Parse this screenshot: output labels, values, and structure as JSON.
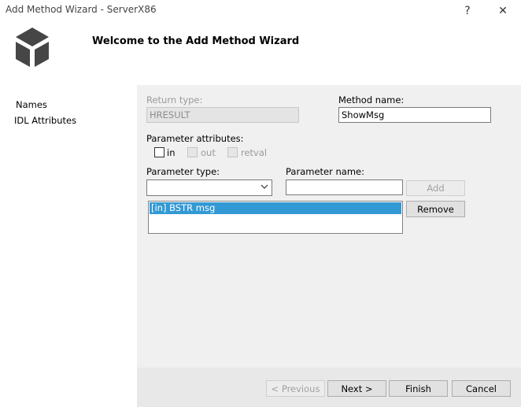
{
  "window": {
    "title": "Add Method Wizard - ServerX86",
    "help_glyph": "?",
    "close_glyph": "✕"
  },
  "header": {
    "title": "Welcome to the Add Method Wizard",
    "logo_icon": "cube-icon"
  },
  "sidebar": {
    "items": [
      {
        "label": "Names"
      },
      {
        "label": "IDL Attributes"
      }
    ]
  },
  "form": {
    "return_type": {
      "label": "Return type:",
      "value": "HRESULT"
    },
    "method_name": {
      "label": "Method name:",
      "value": "ShowMsg"
    },
    "parameter_attributes": {
      "label": "Parameter attributes:",
      "in": {
        "label": "in",
        "checked": false
      },
      "out": {
        "label": "out",
        "checked": false
      },
      "retval": {
        "label": "retval",
        "checked": false
      }
    },
    "parameter_type": {
      "label": "Parameter type:",
      "value": ""
    },
    "parameter_name": {
      "label": "Parameter name:",
      "value": ""
    },
    "add_label": "Add",
    "remove_label": "Remove",
    "parameters": [
      "[in] BSTR msg"
    ]
  },
  "footer": {
    "previous_label": "< Previous",
    "next_label": "Next >",
    "finish_label": "Finish",
    "cancel_label": "Cancel"
  },
  "colors": {
    "selection": "#3399d5",
    "panel": "#f0f0f0"
  }
}
